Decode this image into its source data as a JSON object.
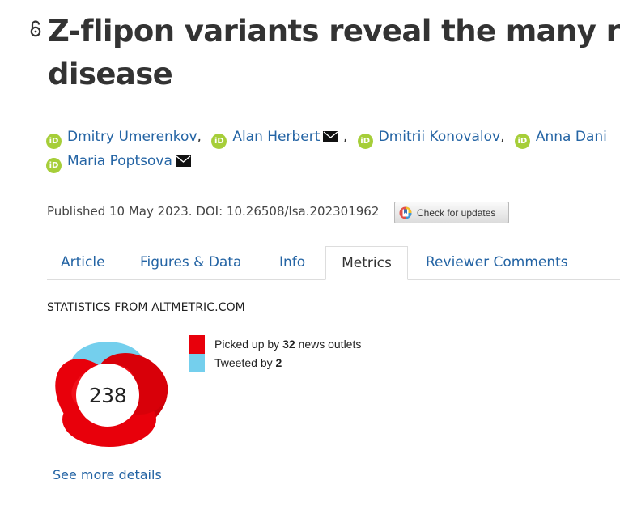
{
  "article": {
    "title_line1": "Z-flipon variants reveal the many roles",
    "title_line2": "disease",
    "open_access_icon": "open-lock-icon"
  },
  "authors": {
    "orcid_label": "iD",
    "list": [
      {
        "name": "Dmitry Umerenkov",
        "has_email": false
      },
      {
        "name": "Alan Herbert",
        "has_email": true
      },
      {
        "name": "Dmitrii Konovalov",
        "has_email": false
      },
      {
        "name": "Anna Dani",
        "has_email": false
      },
      {
        "name": "Maria Poptsova",
        "has_email": true
      }
    ]
  },
  "publication": {
    "published_text": "Published 10 May 2023. DOI: 10.26508/lsa.202301962",
    "check_updates_label": "Check for updates"
  },
  "tabs": [
    {
      "label": "Article",
      "active": false
    },
    {
      "label": "Figures & Data",
      "active": false
    },
    {
      "label": "Info",
      "active": false
    },
    {
      "label": "Metrics",
      "active": true
    },
    {
      "label": "Reviewer Comments",
      "active": false
    }
  ],
  "metrics": {
    "heading": "STATISTICS FROM ALTMETRIC.COM",
    "score": "238",
    "legend": [
      {
        "prefix": "Picked up by ",
        "count": "32",
        "suffix": " news outlets",
        "color": "#e8000b"
      },
      {
        "prefix": "Tweeted by ",
        "count": "2",
        "suffix": "",
        "color": "#74cfed"
      }
    ],
    "see_more_label": "See more details"
  },
  "colors": {
    "link": "#2464a4",
    "orcid": "#a6ce39",
    "news": "#e8000b",
    "twitter": "#74cfed"
  }
}
